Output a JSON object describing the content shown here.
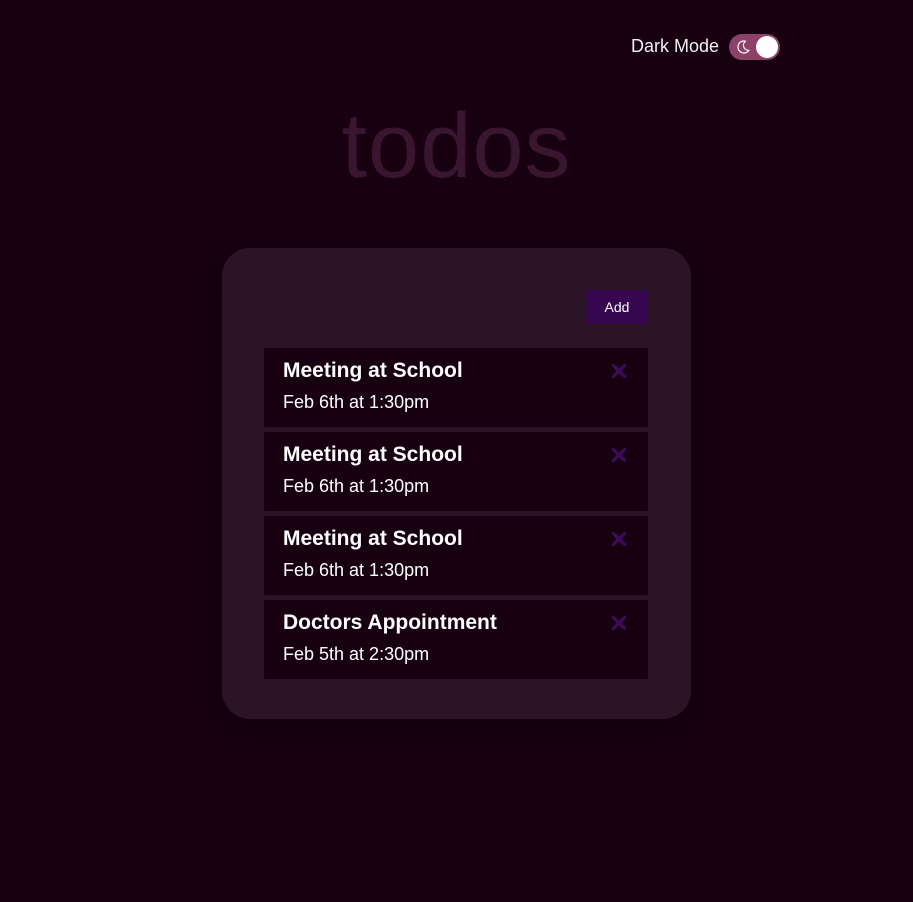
{
  "header": {
    "mode_label": "Dark Mode",
    "mode_enabled": true
  },
  "app": {
    "title": "todos"
  },
  "toolbar": {
    "add_label": "Add"
  },
  "todos": [
    {
      "title": "Meeting at School",
      "date": "Feb 6th at 1:30pm"
    },
    {
      "title": "Meeting at School",
      "date": "Feb 6th at 1:30pm"
    },
    {
      "title": "Meeting at School",
      "date": "Feb 6th at 1:30pm"
    },
    {
      "title": "Doctors Appointment",
      "date": "Feb 5th at 2:30pm"
    }
  ],
  "icons": {
    "toggle": "moon-icon",
    "delete": "close-icon"
  },
  "colors": {
    "background": "#170010",
    "card": "#2c1427",
    "accent": "#36064e",
    "delete_icon": "#3d0a5c",
    "toggle_track": "#8e4168",
    "title_text": "#3a1530"
  }
}
